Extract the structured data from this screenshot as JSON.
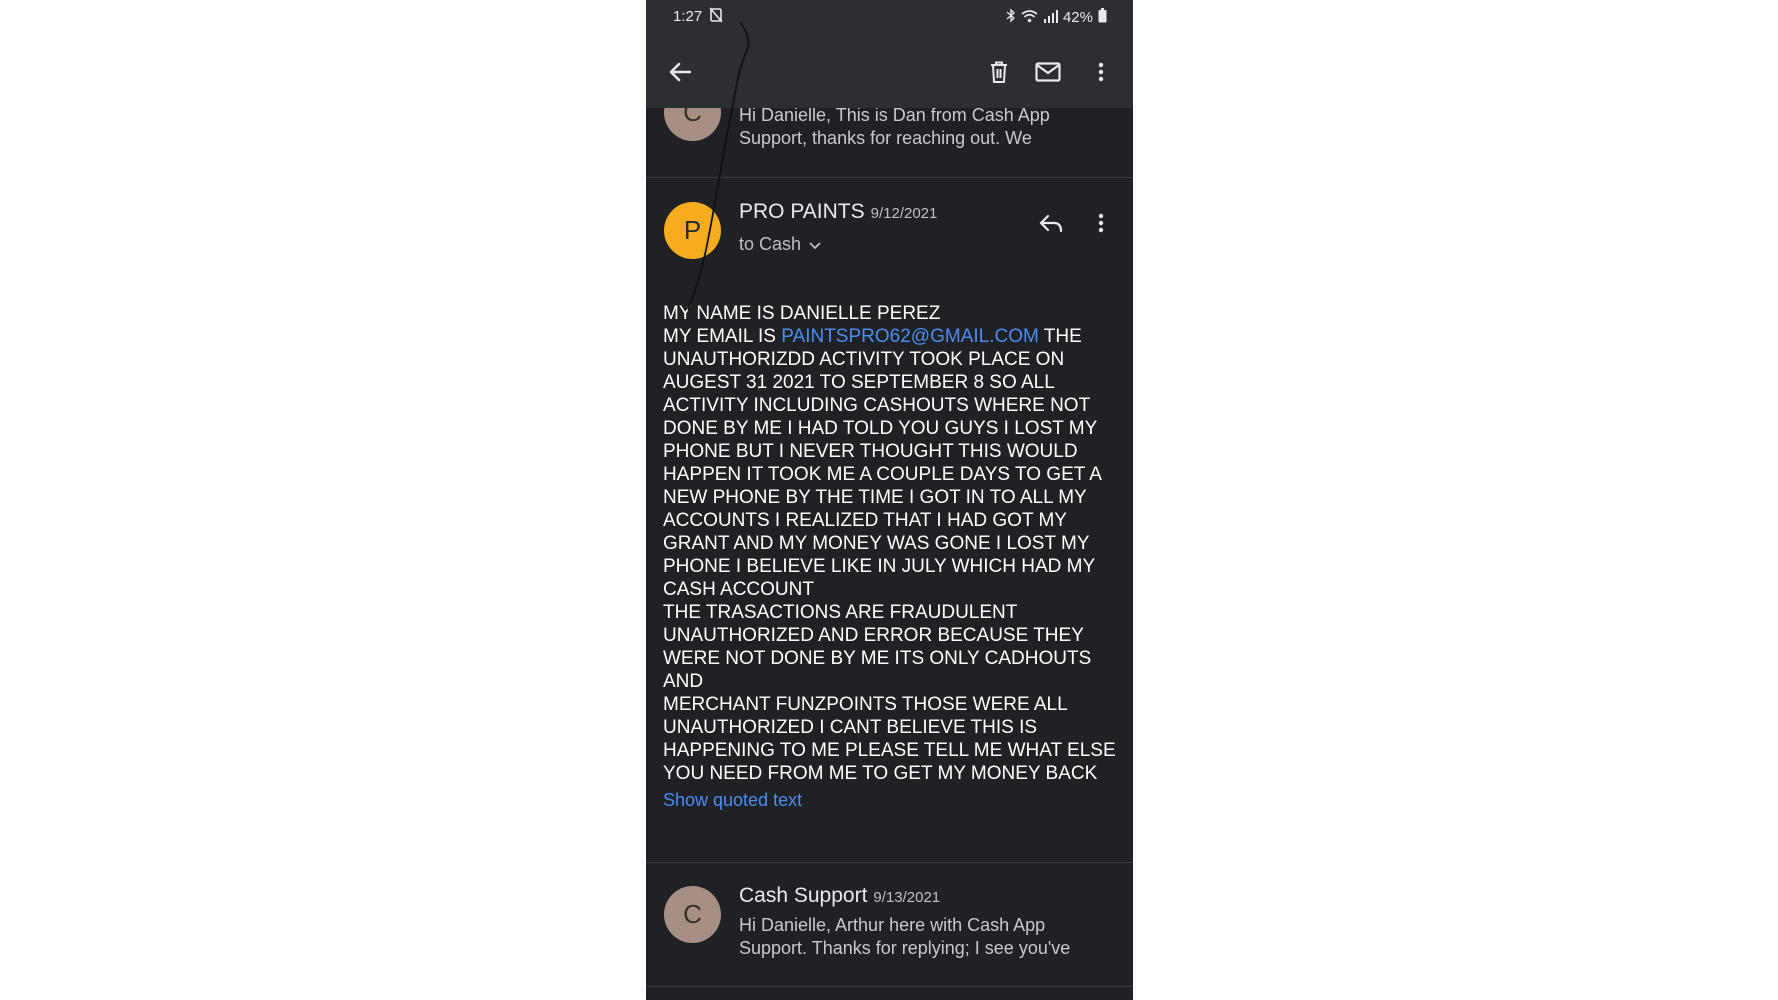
{
  "status_bar": {
    "time": "1:27",
    "battery": "42%",
    "icons": [
      "dnd-icon",
      "bluetooth-icon",
      "wifi-icon",
      "signal-icon",
      "battery-icon"
    ]
  },
  "toolbar": {
    "icons": [
      "back-arrow-icon",
      "trash-icon",
      "mail-icon",
      "more-vert-icon"
    ]
  },
  "messages": {
    "prev": {
      "avatar_letter": "C",
      "snippet_line1": "Hi Danielle, This is Dan from Cash App",
      "snippet_line2": "Support, thanks for reaching out. We"
    },
    "current": {
      "avatar_letter": "P",
      "sender": "PRO PAINTS",
      "date": "9/12/2021",
      "to": "to Cash",
      "body_line1": "MY NAME IS DANIELLE PEREZ",
      "body_email_prefix": "MY EMAIL IS ",
      "body_email": "PAINTSPRO62@GMAIL.COM",
      "body_rest": " THE\nUNAUTHORIZDD ACTIVITY TOOK PLACE ON\nAUGEST 31 2021 TO SEPTEMBER 8 SO ALL\nACTIVITY INCLUDING CASHOUTS WHERE NOT\nDONE BY ME I HAD TOLD YOU GUYS I LOST MY\nPHONE BUT I NEVER THOUGHT THIS WOULD\nHAPPEN IT TOOK ME A COUPLE DAYS TO GET A\nNEW PHONE BY THE TIME I GOT IN TO ALL MY\nACCOUNTS I REALIZED THAT I HAD GOT MY\nGRANT AND MY MONEY WAS GONE I LOST MY\nPHONE I BELIEVE LIKE IN JULY WHICH HAD MY\nCASH ACCOUNT\nTHE TRASACTIONS ARE FRAUDULENT\nUNAUTHORIZED AND ERROR BECAUSE THEY\nWERE NOT DONE BY ME ITS ONLY CADHOUTS AND\nMERCHANT FUNZPOINTS THOSE WERE ALL\nUNAUTHORIZED I CANT BELIEVE THIS IS\nHAPPENING TO ME PLEASE TELL ME WHAT ELSE\nYOU NEED FROM ME TO GET MY MONEY BACK",
      "show_quoted": "Show quoted text"
    },
    "next": {
      "avatar_letter": "C",
      "sender": "Cash Support",
      "date": "9/13/2021",
      "snippet_line1": "Hi Danielle, Arthur here with Cash App",
      "snippet_line2": "Support. Thanks for replying; I see you've"
    }
  },
  "colors": {
    "background": "#202124",
    "toolbar": "#2d2e31",
    "accent_link": "#4a8ef4",
    "avatar_p": "#f6ac1e",
    "avatar_c": "#a88f86"
  }
}
